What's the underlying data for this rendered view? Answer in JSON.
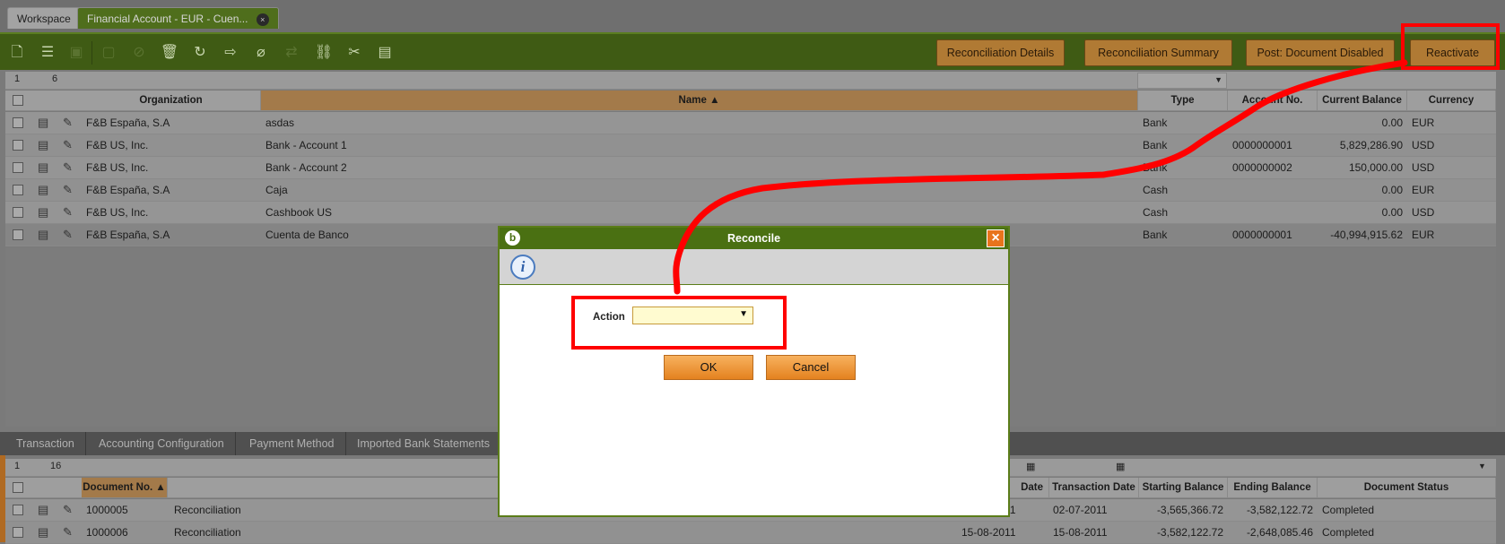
{
  "window_tabs": [
    {
      "label": "Workspace"
    },
    {
      "label": "Financial Account - EUR - Cuen...",
      "close": "×"
    }
  ],
  "toolbar": {
    "buttons": [
      {
        "label": "Reconciliation Details"
      },
      {
        "label": "Reconciliation Summary"
      },
      {
        "label": "Post: Document Disabled"
      },
      {
        "label": "Reactivate"
      }
    ]
  },
  "top_grid": {
    "row_indicator": "1",
    "count": "6",
    "columns": [
      "Organization",
      "Name ▲",
      "Type",
      "Account No.",
      "Current Balance",
      "Currency"
    ],
    "rows": [
      {
        "org": "F&B España, S.A",
        "name": "asdas",
        "type": "Bank",
        "account": "",
        "balance": "0.00",
        "currency": "EUR"
      },
      {
        "org": "F&B US, Inc.",
        "name": "Bank - Account 1",
        "type": "Bank",
        "account": "0000000001",
        "balance": "5,829,286.90",
        "currency": "USD"
      },
      {
        "org": "F&B US, Inc.",
        "name": "Bank - Account 2",
        "type": "Bank",
        "account": "0000000002",
        "balance": "150,000.00",
        "currency": "USD"
      },
      {
        "org": "F&B España, S.A",
        "name": "Caja",
        "type": "Cash",
        "account": "",
        "balance": "0.00",
        "currency": "EUR"
      },
      {
        "org": "F&B US, Inc.",
        "name": "Cashbook US",
        "type": "Cash",
        "account": "",
        "balance": "0.00",
        "currency": "USD"
      },
      {
        "org": "F&B España, S.A",
        "name": "Cuenta de Banco",
        "type": "Bank",
        "account": "0000000001",
        "balance": "-40,994,915.62",
        "currency": "EUR"
      }
    ]
  },
  "lower_tabs": [
    "Transaction",
    "Accounting Configuration",
    "Payment Method",
    "Imported Bank Statements"
  ],
  "bottom_grid": {
    "row_indicator": "1",
    "count": "16",
    "columns": [
      "Document No. ▲",
      "Date",
      "Transaction Date",
      "Starting Balance",
      "Ending Balance",
      "Document Status"
    ],
    "rows": [
      {
        "docno": "1000005",
        "type": "Reconciliation",
        "date": "02-07-2011",
        "tdate": "02-07-2011",
        "start": "-3,565,366.72",
        "end": "-3,582,122.72",
        "status": "Completed"
      },
      {
        "docno": "1000006",
        "type": "Reconciliation",
        "date": "15-08-2011",
        "tdate": "15-08-2011",
        "start": "-3,582,122.72",
        "end": "-2,648,085.46",
        "status": "Completed"
      }
    ]
  },
  "dialog": {
    "title": "Reconcile",
    "info_icon": "i",
    "action_label": "Action",
    "action_value": "",
    "ok_label": "OK",
    "cancel_label": "Cancel",
    "close": "×",
    "logo": "b"
  },
  "colors": {
    "toolbar": "#3f5b14",
    "dialog_title": "#4a7012",
    "button_orange": "#e4821f",
    "annotation_red": "#ff0000"
  }
}
